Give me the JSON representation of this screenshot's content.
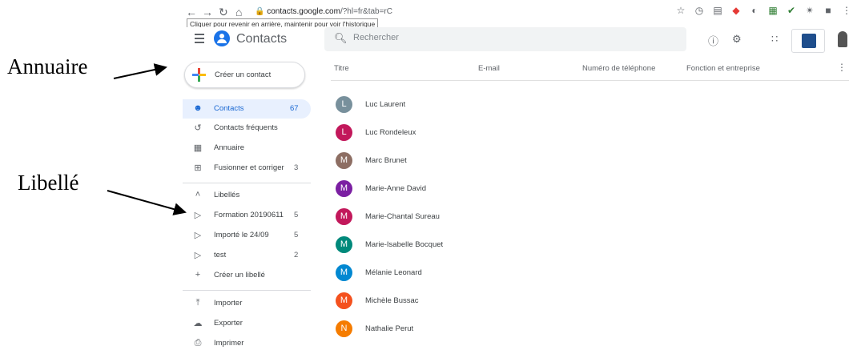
{
  "annotations": {
    "directory": "Annuaire",
    "label": "Libellé"
  },
  "browser": {
    "url_host": "contacts.google.com",
    "url_path": "/?hl=fr&tab=rC",
    "back_tooltip": "Cliquer pour revenir en arrière, maintenir pour voir l'historique"
  },
  "header": {
    "app_title": "Contacts",
    "search_placeholder": "Rechercher"
  },
  "sidebar": {
    "create_contact": "Créer un contact",
    "items": [
      {
        "label": "Contacts",
        "count": "67",
        "icon": "person-icon",
        "active": true
      },
      {
        "label": "Contacts fréquents",
        "count": "",
        "icon": "history-icon"
      },
      {
        "label": "Annuaire",
        "count": "",
        "icon": "domain-icon"
      },
      {
        "label": "Fusionner et corriger",
        "count": "3",
        "icon": "merge-icon"
      }
    ],
    "labels_header": "Libellés",
    "labels": [
      {
        "label": "Formation 20190611",
        "count": "5"
      },
      {
        "label": "Importé le 24/09",
        "count": "5"
      },
      {
        "label": "test",
        "count": "2"
      }
    ],
    "create_label": "Créer un libellé",
    "actions": [
      {
        "label": "Importer",
        "icon": "upload-icon"
      },
      {
        "label": "Exporter",
        "icon": "cloud-download-icon"
      },
      {
        "label": "Imprimer",
        "icon": "print-icon"
      }
    ]
  },
  "list": {
    "columns": [
      "Titre",
      "E-mail",
      "Numéro de téléphone",
      "Fonction et entreprise"
    ],
    "contacts": [
      {
        "initial": "L",
        "name": "Luc Laurent",
        "color": "#78909c"
      },
      {
        "initial": "L",
        "name": "Luc Rondeleux",
        "color": "#c2185b"
      },
      {
        "initial": "M",
        "name": "Marc Brunet",
        "color": "#8d6e63"
      },
      {
        "initial": "M",
        "name": "Marie-Anne David",
        "color": "#7b1fa2"
      },
      {
        "initial": "M",
        "name": "Marie-Chantal Sureau",
        "color": "#c2185b"
      },
      {
        "initial": "M",
        "name": "Marie-Isabelle Bocquet",
        "color": "#00897b"
      },
      {
        "initial": "M",
        "name": "Mélanie Leonard",
        "color": "#0288d1"
      },
      {
        "initial": "M",
        "name": "Michèle Bussac",
        "color": "#f4511e"
      },
      {
        "initial": "N",
        "name": "Nathalie Perut",
        "color": "#f57c00"
      }
    ]
  }
}
